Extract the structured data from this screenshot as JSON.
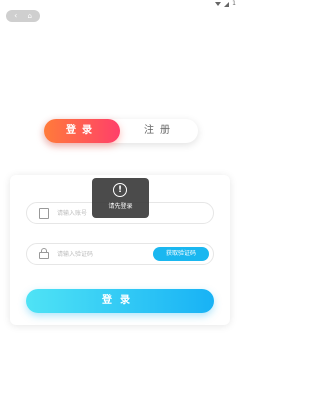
{
  "status_bar": {
    "wifi_icon": "wifi-icon",
    "signal_icon": "signal-icon",
    "signal_text": "1"
  },
  "top_controls": {
    "back_icon": "back-icon",
    "home_icon": "home-icon"
  },
  "tabs": [
    {
      "label": "登录",
      "active": true
    },
    {
      "label": "注册",
      "active": false
    }
  ],
  "form": {
    "phone": {
      "placeholder": "请输入账号",
      "value": "",
      "icon": "phone-icon"
    },
    "code": {
      "placeholder": "请输入验证码",
      "value": "",
      "icon": "lock-icon"
    },
    "get_code_label": "获取验证码",
    "submit_label": "登录"
  },
  "toast": {
    "icon": "exclamation-icon",
    "symbol": "!",
    "message": "请先登录"
  },
  "colors": {
    "login_tab_gradient": [
      "#ff7b3a",
      "#ff3f6a"
    ],
    "submit_gradient": [
      "#4fe3f5",
      "#18b2f5"
    ],
    "code_button": "#1ab7f0"
  }
}
